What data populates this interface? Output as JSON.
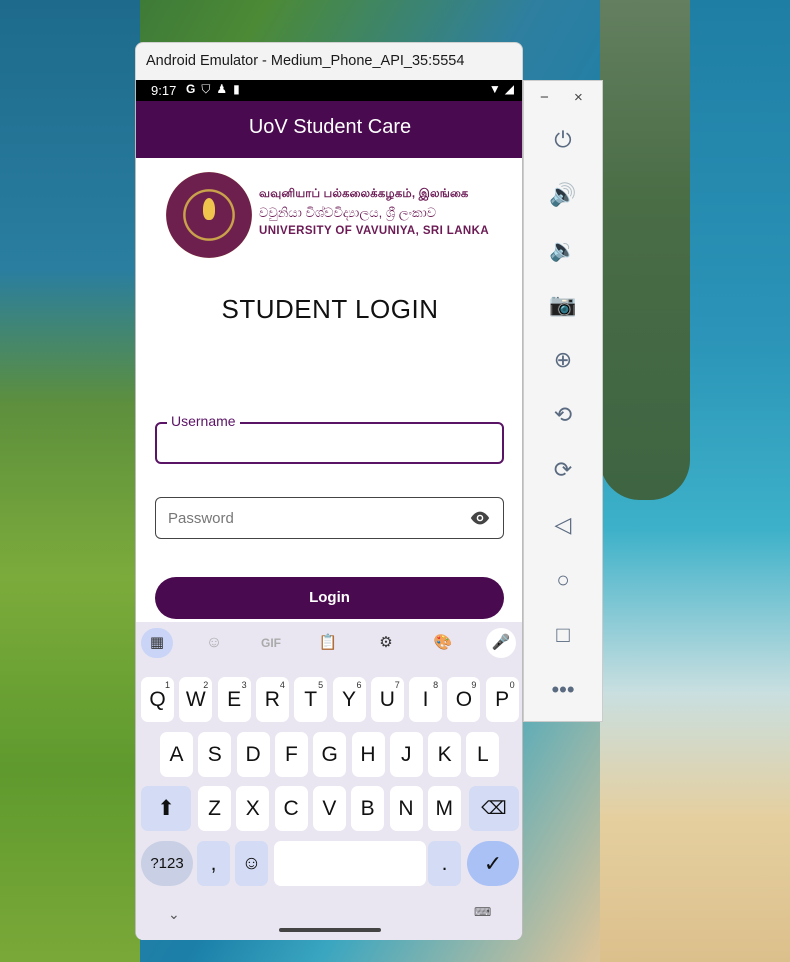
{
  "window": {
    "title": "Android Emulator - Medium_Phone_API_35:5554"
  },
  "status_bar": {
    "time": "9:17"
  },
  "app": {
    "title": "UoV Student Care"
  },
  "logo": {
    "line_tamil": "வவுனியாப் பல்கலைக்கழகம், இலங்கை",
    "line_sinhala": "වවුනියා විශ්වවිද්‍යාලය, ශ්‍රී ලංකාව",
    "line_english": "UNIVERSITY OF VAVUNIYA, SRI LANKA"
  },
  "login": {
    "heading": "STUDENT LOGIN",
    "username_label": "Username",
    "username_value": "",
    "password_placeholder": "Password",
    "password_value": "",
    "button_label": "Login"
  },
  "keyboard": {
    "toolbar": [
      "apps-grid-icon",
      "sticker-icon",
      "GIF",
      "clipboard-icon",
      "settings-icon",
      "palette-icon",
      "mic-icon"
    ],
    "gif_label": "GIF",
    "row1": [
      {
        "k": "Q",
        "n": "1"
      },
      {
        "k": "W",
        "n": "2"
      },
      {
        "k": "E",
        "n": "3"
      },
      {
        "k": "R",
        "n": "4"
      },
      {
        "k": "T",
        "n": "5"
      },
      {
        "k": "Y",
        "n": "6"
      },
      {
        "k": "U",
        "n": "7"
      },
      {
        "k": "I",
        "n": "8"
      },
      {
        "k": "O",
        "n": "9"
      },
      {
        "k": "P",
        "n": "0"
      }
    ],
    "row2": [
      "A",
      "S",
      "D",
      "F",
      "G",
      "H",
      "J",
      "K",
      "L"
    ],
    "row3": [
      "Z",
      "X",
      "C",
      "V",
      "B",
      "N",
      "M"
    ],
    "symbols_key": "?123",
    "comma_key": ",",
    "period_key": "."
  },
  "colors": {
    "brand_purple": "#4a0a4f",
    "keyboard_bg": "#e9e6f2",
    "enter_key": "#a9c1f5"
  }
}
